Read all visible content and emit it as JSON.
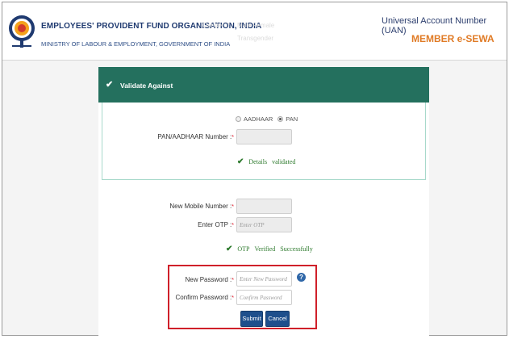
{
  "header": {
    "org_name": "EMPLOYEES' PROVIDENT FUND ORGANISATION, INDIA",
    "ministry": "MINISTRY OF LABOUR & EMPLOYMENT, GOVERNMENT OF INDIA",
    "uan_title": "Universal Account Number (UAN)",
    "portal_name": "MEMBER e-SEWA",
    "ghost_gender": "Gender :*",
    "ghost_options": "Male   Female",
    "ghost_transgender": "Transgender"
  },
  "validate": {
    "title": "Validate Against",
    "radio_aadhaar": "AADHAAR",
    "radio_pan": "PAN",
    "selected": "PAN",
    "number_label": "PAN/AADHAAR Number :",
    "number_value": "",
    "status": "Details",
    "status_word": "validated"
  },
  "mobile": {
    "label": "New Mobile Number :",
    "value": ""
  },
  "otp": {
    "label": "Enter OTP :",
    "placeholder": "Enter OTP",
    "status_1": "OTP",
    "status_2": "Verified",
    "status_3": "Successfully"
  },
  "password": {
    "new_label": "New Password :",
    "new_placeholder": "Enter New Password",
    "confirm_label": "Confirm Password :",
    "confirm_placeholder": "Confirm Password",
    "help_symbol": "?",
    "required_mark": "*"
  },
  "buttons": {
    "submit": "Submit",
    "cancel": "Cancel"
  },
  "colors": {
    "panel_header": "#24705e",
    "button": "#1e4f8c",
    "highlight_border": "#d0202a",
    "accent_orange": "#e07b26"
  }
}
